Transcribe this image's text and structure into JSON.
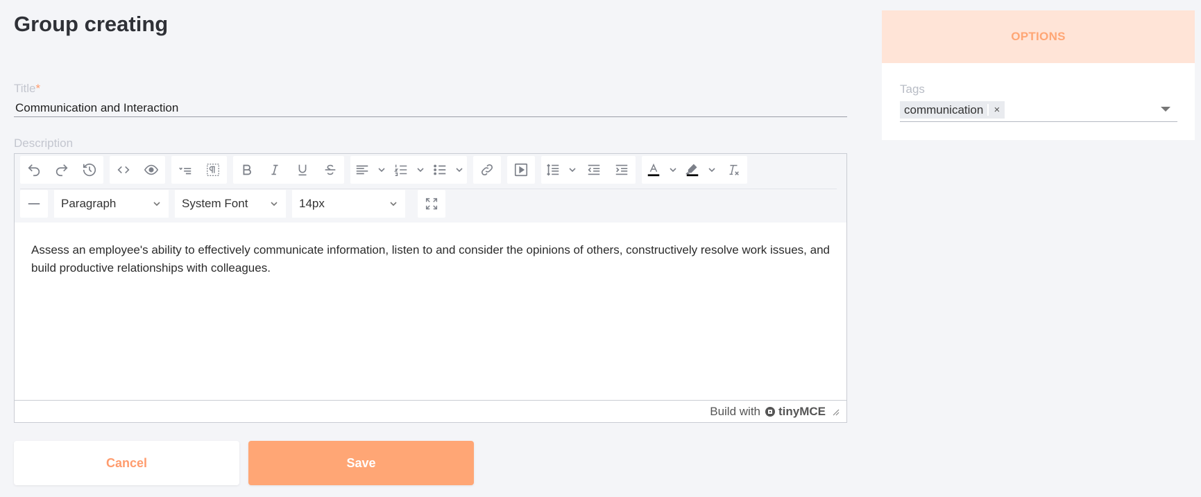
{
  "page": {
    "title": "Group creating"
  },
  "form": {
    "title_label": "Title",
    "title_required_mark": "*",
    "title_value": "Communication and Interaction",
    "description_label": "Description"
  },
  "editor": {
    "toolbar": {
      "row1": [
        [
          "undo-icon",
          "redo-icon",
          "history-icon"
        ],
        [
          "source-code-icon",
          "preview-icon"
        ],
        [
          "list-style-icon",
          "show-blocks-icon"
        ],
        [
          "bold-icon",
          "italic-icon",
          "underline-icon",
          "strikethrough-icon"
        ],
        [
          "align-left-icon",
          "numbered-list-icon",
          "bullet-list-icon"
        ],
        [
          "link-icon"
        ],
        [
          "media-icon"
        ],
        [
          "line-height-icon",
          "outdent-icon",
          "indent-icon"
        ],
        [
          "text-color-icon",
          "highlight-color-icon",
          "clear-formatting-icon"
        ]
      ],
      "block_format": "Paragraph",
      "font_family": "System Font",
      "font_size": "14px",
      "text_color": "#000000",
      "highlight_color": "#000000"
    },
    "content": "Assess an employee's ability to effectively communicate information, listen to and consider the opinions of others, constructively resolve work issues, and build productive relationships with colleagues.",
    "status": {
      "built_with": "Build with",
      "brand": "tinyMCE"
    }
  },
  "actions": {
    "cancel_label": "Cancel",
    "save_label": "Save"
  },
  "options": {
    "header": "OPTIONS",
    "tags_label": "Tags",
    "tags": [
      "communication"
    ],
    "tag_remove": "×"
  },
  "colors": {
    "accent": "#ffa675",
    "accent_light": "#ffe4d7",
    "background": "#f4f5f8"
  }
}
